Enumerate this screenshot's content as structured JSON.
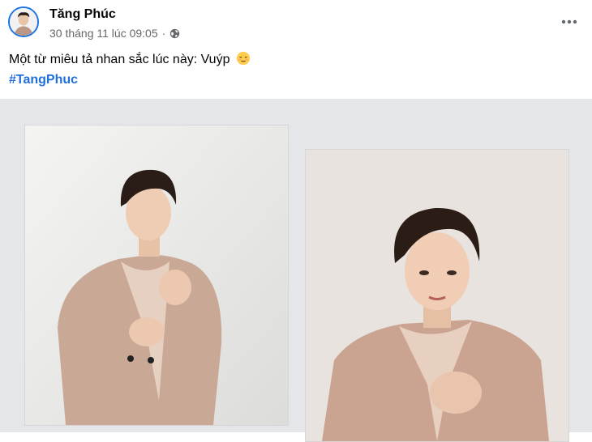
{
  "post": {
    "author_name": "Tăng Phúc",
    "timestamp": "30 tháng 11 lúc 09:05",
    "separator": "·",
    "privacy_icon": "globe-icon",
    "more_icon": "more-dots-icon",
    "text": "Một từ miêu tả nhan sắc lúc này: Vuýp",
    "emoji": "relieved-face-emoji",
    "hashtag": "#TangPhuc"
  },
  "colors": {
    "accent": "#1b74e4",
    "hashtag": "#216fdb",
    "meta": "#65676b",
    "media_background": "#e4e6e9"
  },
  "photos": [
    {
      "description_icon": "portrait-photo"
    },
    {
      "description_icon": "portrait-photo"
    }
  ]
}
